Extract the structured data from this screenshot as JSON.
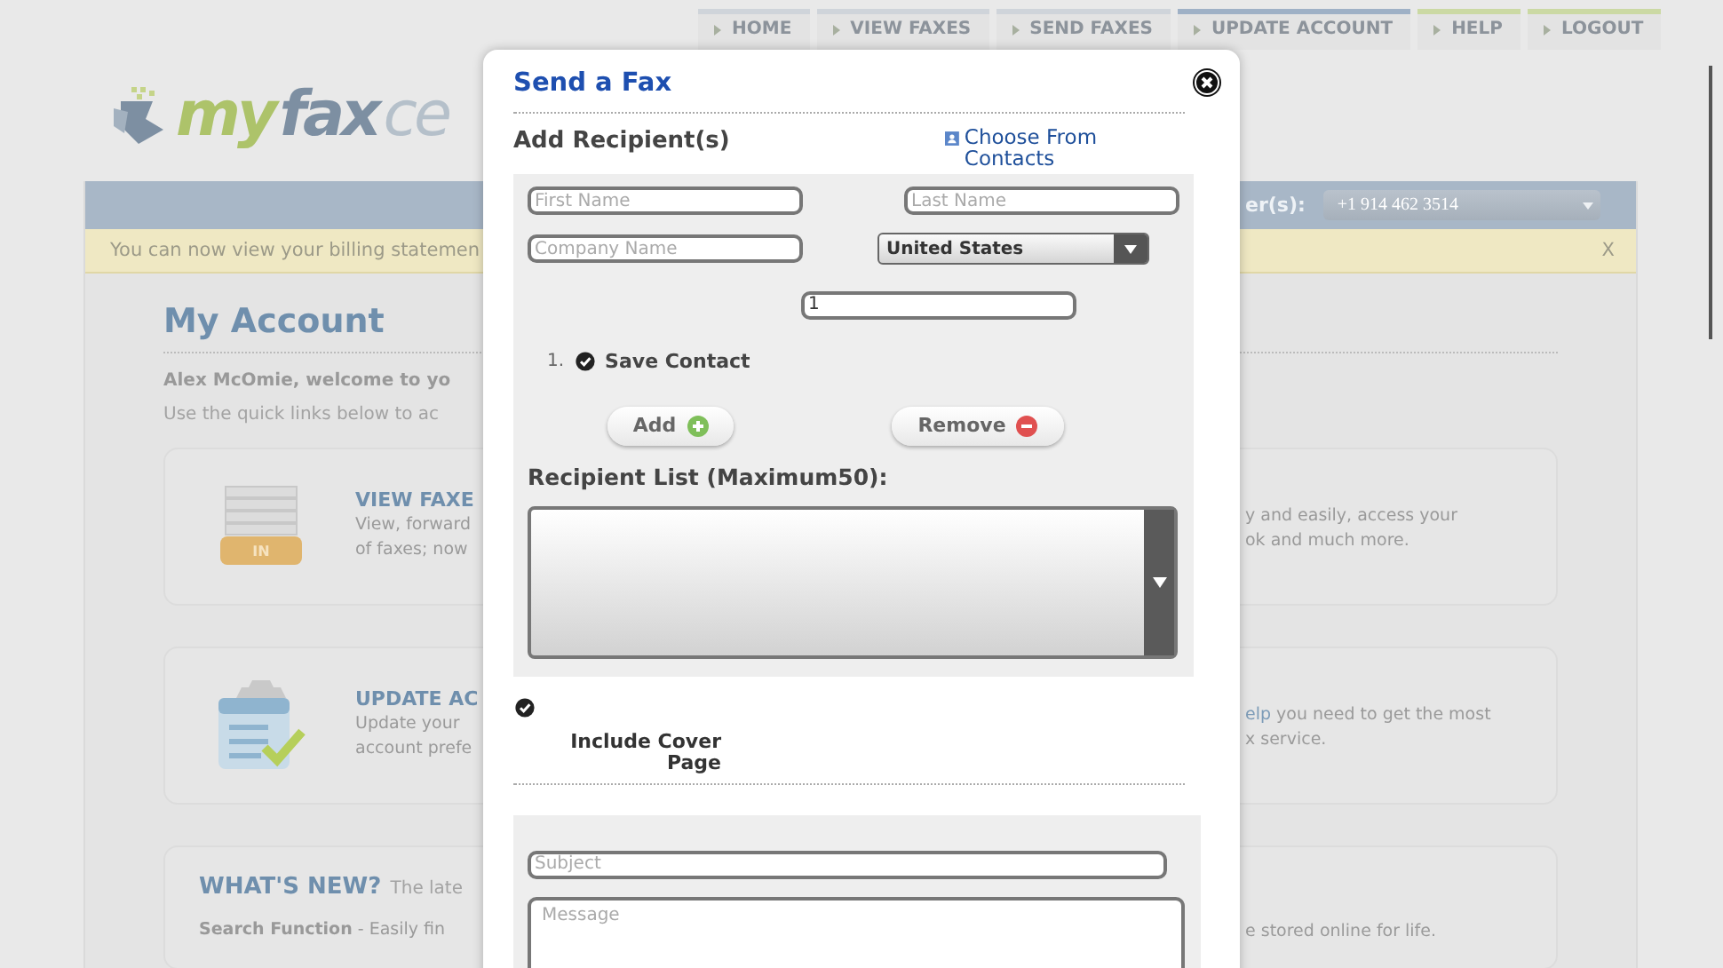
{
  "nav": [
    {
      "label": "HOME",
      "color": "#cfd4da"
    },
    {
      "label": "VIEW FAXES",
      "color": "#cfd4da"
    },
    {
      "label": "SEND FAXES",
      "color": "#cfd4da"
    },
    {
      "label": "UPDATE ACCOUNT",
      "color": "#9fb1c6"
    },
    {
      "label": "HELP",
      "color": "#cbd9a4"
    },
    {
      "label": "LOGOUT",
      "color": "#cbd9a4"
    }
  ],
  "logo": {
    "part_1": "my",
    "part_2": "fax",
    "part_3": "ce"
  },
  "account_bar": {
    "label": "er(s):",
    "number": "+1 914 462 3514"
  },
  "notice": {
    "text": "You can now view your billing statemen",
    "close": "X"
  },
  "account": {
    "title": "My Account",
    "welcome": "Alex McOmie, welcome to yo",
    "hint": "Use the quick links below to ac"
  },
  "cards": [
    {
      "kind": "inbox",
      "icon_label": "IN",
      "title": "VIEW FAXE",
      "left_lines": [
        "View, forward",
        "of faxes; now"
      ],
      "right_lines": [
        {
          "text": "y and easily, access your"
        },
        {
          "text": "ok and much more."
        }
      ]
    },
    {
      "kind": "settings",
      "title": "UPDATE AC",
      "left_lines": [
        "Update your",
        "account prefe"
      ],
      "right_lines": [
        {
          "link": "elp",
          "text": " you need to get the most"
        },
        {
          "text": "x service."
        }
      ]
    },
    {
      "kind": "news",
      "title": "WHAT'S NEW?",
      "subtitle": "The late",
      "left_lines": [
        "**Search Function** - Easily fin"
      ],
      "right_lines": [
        {
          "text": "e stored online for life."
        }
      ]
    }
  ],
  "dialog": {
    "title": "Send a Fax",
    "section": "Add Recipient(s)",
    "contacts_link": "Choose From Contacts",
    "first_name": {
      "placeholder": "First Name"
    },
    "last_name": {
      "placeholder": "Last Name"
    },
    "company": {
      "placeholder": "Company Name"
    },
    "country": "United States",
    "fax_number": {
      "value": "1"
    },
    "contacts": [
      {
        "number": "1.",
        "label": "Save Contact",
        "checked": true
      }
    ],
    "add_button": "Add",
    "remove_button": "Remove",
    "list_label": "Recipient List (Maximum50):",
    "cover_page": {
      "label": "Include Cover Page",
      "checked": true
    },
    "subject": {
      "placeholder": "Subject"
    },
    "message": {
      "placeholder": "Message"
    }
  }
}
